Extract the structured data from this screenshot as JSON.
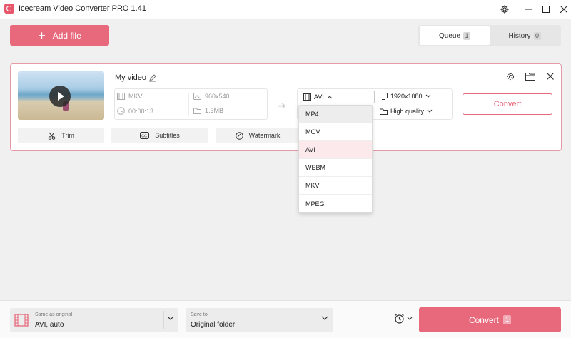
{
  "app": {
    "title": "Icecream Video Converter PRO 1.41"
  },
  "toolbar": {
    "add_file_label": "Add file"
  },
  "tabs": [
    {
      "label": "Queue",
      "count": "1",
      "active": true
    },
    {
      "label": "History",
      "count": "0",
      "active": false
    }
  ],
  "item": {
    "name": "My video",
    "source": {
      "format": "MKV",
      "resolution": "960x540",
      "duration": "00:00:13",
      "size": "1.3MB"
    },
    "output": {
      "format": "AVI",
      "resolution": "1920x1080",
      "quality": "High quality"
    },
    "convert_label": "Convert",
    "tools": {
      "trim": "Trim",
      "subtitles": "Subtitles",
      "watermark": "Watermark"
    }
  },
  "format_dropdown": {
    "options": [
      "MP4",
      "MOV",
      "AVI",
      "WEBM",
      "MKV",
      "MPEG"
    ],
    "selected": "AVI",
    "hovered": "MP4"
  },
  "bottom": {
    "preset_caption": "Same as original",
    "preset_value": "AVI, auto",
    "save_caption": "Save to:",
    "save_value": "Original folder",
    "convert_label": "Convert",
    "convert_count": "1"
  },
  "colors": {
    "accent": "#e8697c",
    "card_border": "#e69aa6"
  }
}
